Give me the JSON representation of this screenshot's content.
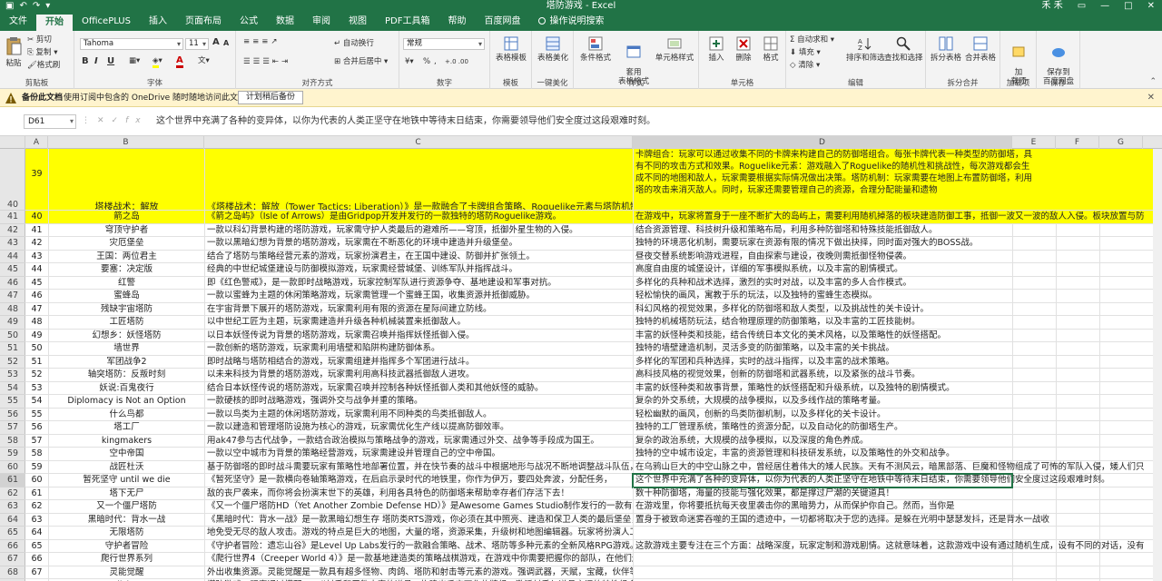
{
  "title": "塔防游戏 - Excel",
  "user": "禾 禾",
  "tabs": [
    "文件",
    "开始",
    "OfficePLUS",
    "插入",
    "页面布局",
    "公式",
    "数据",
    "审阅",
    "视图",
    "PDF工具箱",
    "帮助",
    "百度网盘",
    "操作说明搜索"
  ],
  "ribbon": {
    "clipboard": {
      "paste": "粘贴",
      "cut": "剪切",
      "copy": "复制 ▾",
      "format_painter": "格式刷",
      "label": "剪贴板"
    },
    "font": {
      "name": "Tahoma",
      "size": "11",
      "grow": "A",
      "shrink": "A",
      "bold": "B",
      "italic": "I",
      "underline": "U",
      "wen": "文",
      "fontcolor": "A",
      "label": "字体"
    },
    "align": {
      "wrap": "自动换行",
      "merge": "合并后居中 ▾",
      "label": "对齐方式"
    },
    "number": {
      "format": "常规",
      "percent": "%",
      "comma": ",",
      "label": "数字"
    },
    "template": {
      "table_template": "表格模板",
      "label": "模板"
    },
    "beautify": {
      "table_beautify": "表格美化",
      "label": "一键美化"
    },
    "styles": {
      "conditional": "条件格式",
      "as_table": "套用\n表格格式",
      "cell_style": "单元格样式",
      "label": "样式"
    },
    "cells": {
      "insert": "插入",
      "delete": "删除",
      "format": "格式",
      "label": "单元格"
    },
    "editing": {
      "autosum": "自动求和 ▾",
      "fill": "填充 ▾",
      "clear": "清除 ▾",
      "sort": "排序和筛选",
      "find": "查找和选择",
      "label": "编辑"
    },
    "split": {
      "split_table": "拆分表格",
      "merge_table": "合并表格",
      "label": "拆分合并"
    },
    "addins": {
      "add": "加\n载项",
      "label": "加载项"
    },
    "save": {
      "baidu": "保存到\n百度网盘",
      "label": "保存"
    }
  },
  "notice": {
    "title": "备份此文档",
    "text": "使用订阅中包含的 OneDrive 随时随地访问此文件。",
    "button": "计划稍后备份"
  },
  "formula": {
    "namebox": "D61",
    "value": "这个世界中充满了各种的变异体，以你为代表的人类正坚守在地铁中等待末日结束，你需要领导他们安全度过这段艰难时刻。"
  },
  "columns": [
    "A",
    "B",
    "C",
    "D",
    "E",
    "F",
    "G"
  ],
  "row_numbers": [
    "40",
    "41",
    "42",
    "43",
    "44",
    "45",
    "46",
    "47",
    "48",
    "49",
    "50",
    "51",
    "52",
    "53",
    "54",
    "55",
    "56",
    "57",
    "58",
    "59",
    "60",
    "61",
    "62",
    "63",
    "64",
    "65",
    "66",
    "67",
    "68"
  ],
  "rows": [
    {
      "a": "39",
      "b": "塔楼战术：解放",
      "c": "《塔楼战术：解放（Tower Tactics: Liberation）》是一款融合了卡牌组合策略、Roguelike元素与塔防机制",
      "d": "卡牌组合：玩家可以通过收集不同的卡牌来构建自己的防御塔组合。每张卡牌代表一种类型的防御塔，具有不同的攻击方式和效果。Roguelike元素：游戏融入了Roguelike的随机性和挑战性，每次游戏都会生成不同的地图和敌人，玩家需要根据实际情况做出决策。塔防机制：玩家需要在地图上布置防御塔，利用塔的攻击来消灭敌人。同时，玩家还需要管理自己的资源，合理分配能量和遗物"
    },
    {
      "a": "40",
      "b": "箭之岛",
      "c": "《箭之岛屿》（Isle of Arrows）是由Gridpop开发并发行的一款独特的塔防Roguelike游戏。",
      "d": "在游戏中，玩家将置身于一座不断扩大的岛屿上，需要利用随机掉落的板块建造防御工事，抵御一波又一波的敌人入侵。板块放置与防"
    },
    {
      "a": "41",
      "b": "穹顶守护者",
      "c": "一款以科幻背景构建的塔防游戏，玩家需守护人类最后的避难所——穹顶，抵御外星生物的入侵。",
      "d": "结合资源管理、科技树升级和策略布局，利用多种防御塔和特殊技能抵御敌人。"
    },
    {
      "a": "42",
      "b": "灾厄堡垒",
      "c": "一款以黑暗幻想为背景的塔防游戏，玩家需在不断恶化的环境中建造并升级堡垒。",
      "d": "独特的环境恶化机制，需要玩家在资源有限的情况下做出抉择，同时面对强大的BOSS战。"
    },
    {
      "a": "43",
      "b": "王国：两位君主",
      "c": "结合了塔防与策略经营元素的游戏，玩家扮演君主，在王国中建设、防御并扩张领土。",
      "d": "昼夜交替系统影响游戏进程，自由探索与建设，夜晚则需抵御怪物侵袭。"
    },
    {
      "a": "44",
      "b": "要塞：决定版",
      "c": "经典的中世纪城堡建设与防御模拟游戏，玩家需经营城堡、训练军队并指挥战斗。",
      "d": "高度自由度的城堡设计，详细的军事模拟系统，以及丰富的剧情模式。"
    },
    {
      "a": "45",
      "b": "红警",
      "c": "即《红色警戒》，是一款即时战略游戏，玩家控制军队进行资源争夺、基地建设和军事对抗。",
      "d": "多样化的兵种和战术选择，激烈的实时对战，以及丰富的多人合作模式。"
    },
    {
      "a": "46",
      "b": "蜜蜂岛",
      "c": "一款以蜜蜂为主题的休闲策略游戏，玩家需管理一个蜜蜂王国，收集资源并抵御威胁。",
      "d": "轻松愉快的画风，寓教于乐的玩法，以及独特的蜜蜂生态模拟。"
    },
    {
      "a": "47",
      "b": "残缺宇宙塔防",
      "c": "在宇宙背景下展开的塔防游戏，玩家需利用有限的资源在星际间建立防线。",
      "d": "科幻风格的视觉效果，多样化的防御塔和敌人类型，以及挑战性的关卡设计。"
    },
    {
      "a": "48",
      "b": "工匠塔防",
      "c": "以中世纪工匠为主题，玩家需建造并升级各种机械装置来抵御敌人。",
      "d": "独特的机械塔防玩法，结合物理原理的防御策略，以及丰富的工匠技能树。"
    },
    {
      "a": "49",
      "b": "幻想乡：妖怪塔防",
      "c": "以日本妖怪传说为背景的塔防游戏，玩家需召唤并指挥妖怪抵御入侵。",
      "d": "丰富的妖怪种类和技能，结合传统日本文化的美术风格，以及策略性的妖怪搭配。"
    },
    {
      "a": "50",
      "b": "墙世界",
      "c": "一款创新的塔防游戏，玩家需利用墙壁和陷阱构建防御体系。",
      "d": "独特的墙壁建造机制，灵活多变的防御策略，以及丰富的关卡挑战。"
    },
    {
      "a": "51",
      "b": "军团战争2",
      "c": "即时战略与塔防相结合的游戏，玩家需组建并指挥多个军团进行战斗。",
      "d": "多样化的军团和兵种选择，实时的战斗指挥，以及丰富的战术策略。"
    },
    {
      "a": "52",
      "b": "轴突塔防：反叛时刻",
      "c": "以未来科技为背景的塔防游戏，玩家需利用高科技武器抵御敌人进攻。",
      "d": "高科技风格的视觉效果，创新的防御塔和武器系统，以及紧张的战斗节奏。"
    },
    {
      "a": "53",
      "b": "妖说:百鬼夜行",
      "c": "结合日本妖怪传说的塔防游戏，玩家需召唤并控制各种妖怪抵御人类和其他妖怪的威胁。",
      "d": "丰富的妖怪种类和故事背景，策略性的妖怪搭配和升级系统，以及独特的剧情模式。"
    },
    {
      "a": "54",
      "b": "Diplomacy is Not an Option",
      "c": "一款硬核的即时战略游戏，强调外交与战争并重的策略。",
      "d": "复杂的外交系统，大规模的战争模拟，以及多线作战的策略考量。"
    },
    {
      "a": "55",
      "b": "什么鸟都",
      "c": "一款以鸟类为主题的休闲塔防游戏，玩家需利用不同种类的鸟类抵御敌人。",
      "d": "轻松幽默的画风，创新的鸟类防御机制，以及多样化的关卡设计。"
    },
    {
      "a": "56",
      "b": "塔工厂",
      "c": "一款以建造和管理塔防设施为核心的游戏，玩家需优化生产线以提高防御效率。",
      "d": "独特的工厂管理系统，策略性的资源分配，以及自动化的防御塔生产。"
    },
    {
      "a": "57",
      "b": "kingmakers",
      "c": "用ak47参与古代战争，一款结合政治模拟与策略战争的游戏，玩家需通过外交、战争等手段成为国王。",
      "d": "复杂的政治系统，大规模的战争模拟，以及深度的角色养成。"
    },
    {
      "a": "58",
      "b": "空中帝国",
      "c": "一款以空中城市为背景的策略经营游戏，玩家需建设并管理自己的空中帝国。",
      "d": "独特的空中城市设定，丰富的资源管理和科技研发系统，以及策略性的外交和战争。"
    },
    {
      "a": "59",
      "b": "战匠杜沃",
      "c": "基于防御塔的即时战斗需要玩家有策略性地部署位置，并在快节奏的战斗中根据地形与战况不断地调整战斗队伍，",
      "d": "在乌鸦山巨大的中空山脉之中，曾经居住着伟大的矮人民族。天有不测风云，暗黑部落、巨魔和怪物组成了可怖的军队入侵，矮人们只"
    },
    {
      "a": "60",
      "b": "暂死坚守 until we die",
      "c": "《暂死坚守》是一款横向卷轴策略游戏，在后启示录时代的地铁里，你作为伊万，要四处奔波，分配任务，",
      "d": "这个世界中充满了各种的变异体，以你为代表的人类正坚守在地铁中等待末日结束，你需要领导他们安全度过这段艰难时刻。"
    },
    {
      "a": "61",
      "b": "塔下无尸",
      "c": "敌的丧尸袭来，而你将会扮演末世下的英雄，利用各具特色的防御塔来帮助幸存者们存活下去！",
      "d": "数十种防御塔，海量的技能与强化效果，都是撑过尸潮的关键道具！"
    },
    {
      "a": "62",
      "b": "又一个僵尸塔防",
      "c": "《又一个僵尸塔防HD（Yet Another Zombie Defense HD）》是Awesome Games Studio制作发行的一款有着塔防、策略、射击等元素的僵尸题材游戏。",
      "d": "在游戏里，你将要抵抗每天夜里袭击你的黑暗势力，从而保护你自己。然而，当你是"
    },
    {
      "a": "63",
      "b": "黑暗时代：背水一战",
      "c": "《黑暗时代：背水一战》是一款黑暗幻想生存 塔防类RTS游戏，你必须在其中照亮、建造和保卫人类的最后堡垒，对抗无情的噩梦。",
      "d": "置身于被致命迷雾吞噬的王国的遗迹中，一切都将取决于您的选择。是躲在光明中瑟瑟发抖，还是背水一战收"
    },
    {
      "a": "64",
      "b": "无限塔防",
      "c": "地免受无尽的敌人攻击。游戏的特点是巨大的地图，大量的塔，资源采集，升级树和地图编辑器。玩家将扮演人工智能训练计划的志愿者，并将逐渐发现新的塔及其能力，和挖掘资源的方法。",
      "d": ""
    },
    {
      "a": "65",
      "b": "守护者冒险",
      "c": "《守护者冒险：遗忘山谷》是Level Up Labs发行的一款融合策略、战术、塔防等多种元素的全新风格RPG游戏。",
      "d": "这款游戏主要专注在三个方面：战略深度，玩家定制和游戏剧情。这就意味着，这款游戏中设有通过随机生成，设有不同的对话，没有"
    },
    {
      "a": "66",
      "b": "爬行世界系列",
      "c": "《爬行世界4（Creeper World 4）》是一款基地建造类的策略战棋游戏，在游戏中你需要把握你的部队，在他们还没填满地图中时，与它们展开一场策略战斗，尽量避免不会们攻击，最终对敌人进行毁灭性的打击。",
      "d": ""
    },
    {
      "a": "67",
      "b": "灵能觉醒",
      "c": "外出收集资源。灵能觉醒是一款具有超多怪物、肉鸽、塔防和射击等元素的游戏。强调武器，天赋，宝藏，伙伴等多样性装备和组合。",
      "d": ""
    },
    {
      "a": "68",
      "b": "emojishooter",
      "c": "塔防游戏。玩家通过搭配Emoji射手和无数丰富的道具，构建出千变万化的牌组，激活射手与道具之间的特性组合，战胜越来越强大的来自网络世界的梗怪物。",
      "d": ""
    }
  ],
  "colors": {
    "accent": "#217346",
    "highlight": "#ffff00"
  }
}
